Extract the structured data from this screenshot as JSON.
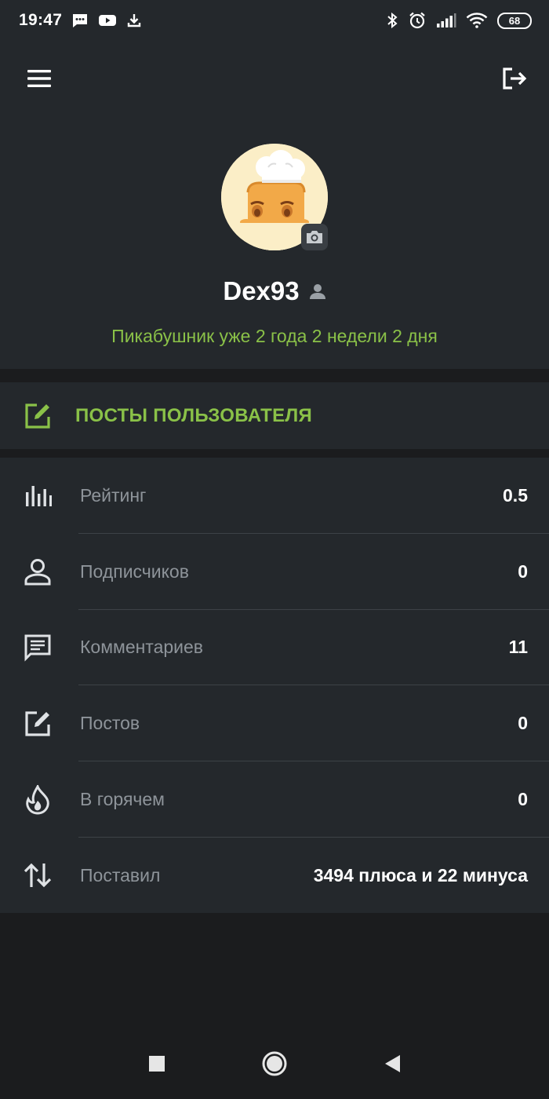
{
  "status_bar": {
    "time": "19:47",
    "battery": "68",
    "icons": [
      "message-icon",
      "youtube-icon",
      "download-icon",
      "bluetooth-icon",
      "alarm-icon",
      "signal-icon",
      "wifi-icon",
      "battery-icon"
    ]
  },
  "profile": {
    "username": "Dex93",
    "since_text": "Пикабушник уже 2 года 2 недели 2 дня"
  },
  "posts_button": {
    "label": "ПОСТЫ ПОЛЬЗОВАТЕЛЯ"
  },
  "stats": [
    {
      "icon": "rating-icon",
      "label": "Рейтинг",
      "value": "0.5"
    },
    {
      "icon": "subscribers-icon",
      "label": "Подписчиков",
      "value": "0"
    },
    {
      "icon": "comments-icon",
      "label": "Комментариев",
      "value": "11"
    },
    {
      "icon": "posts-icon",
      "label": "Постов",
      "value": "0"
    },
    {
      "icon": "hot-icon",
      "label": "В горячем",
      "value": "0"
    },
    {
      "icon": "votes-icon",
      "label": "Поставил",
      "value": "3494 плюса и 22 минуса"
    }
  ],
  "colors": {
    "accent_green": "#8ac148",
    "panel": "#24282c",
    "background": "#1b1c1e",
    "muted_text": "#8e949a"
  }
}
